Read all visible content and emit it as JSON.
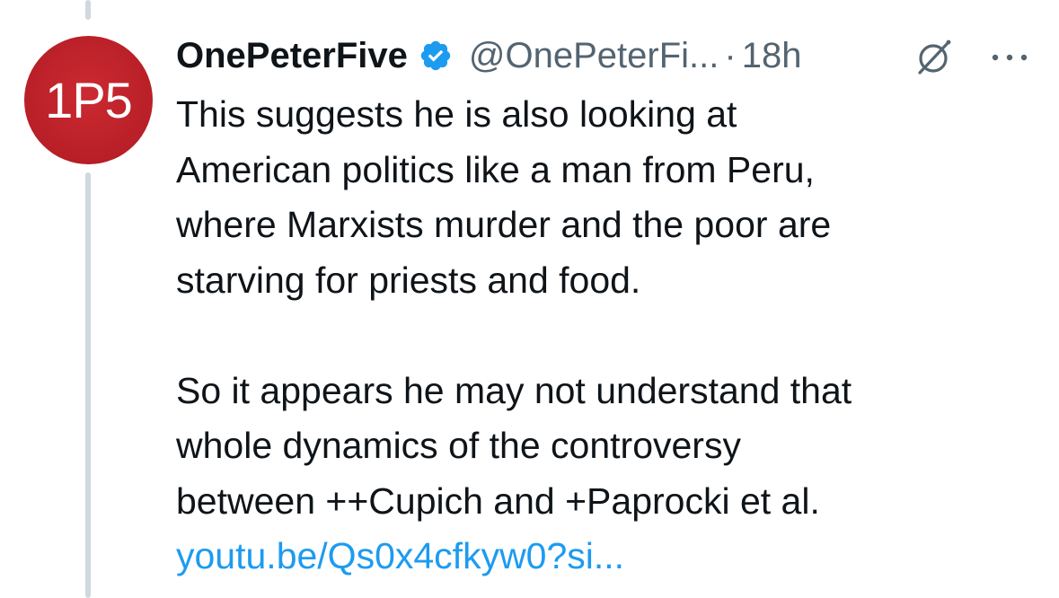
{
  "tweet": {
    "avatar": {
      "text": "1P5",
      "color": "#c0232b"
    },
    "author": {
      "display_name": "OnePeterFive",
      "handle": "@OnePeterFi...",
      "verified_color": "#1d9bf0"
    },
    "separator": "·",
    "time": "18h",
    "icons": {
      "grok": "grok-icon",
      "more": "more-icon",
      "verified": "verified-badge-icon"
    },
    "paragraph_1": "This suggests he is also looking at\nAmerican politics like a man from Peru,\nwhere Marxists murder and the poor are\nstarving for priests and food.",
    "paragraph_2": "So it appears he may not understand that\nwhole dynamics of the controversy\nbetween ++Cupich and +Paprocki et al.",
    "link_text": "youtu.be/Qs0x4cfkyw0?si...",
    "link_color": "#1d9bf0"
  }
}
